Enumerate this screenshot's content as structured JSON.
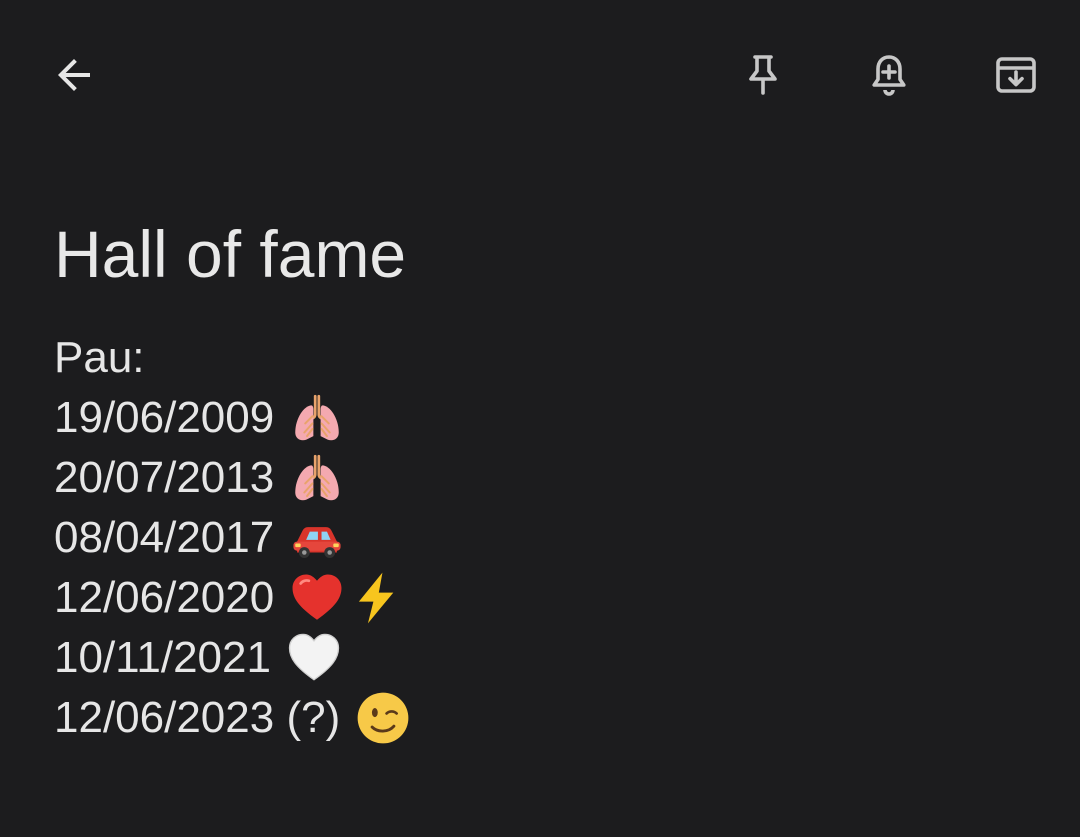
{
  "toolbar": {
    "back_icon": "arrow-left-icon",
    "pin_icon": "pin-icon",
    "reminder_icon": "bell-plus-icon",
    "archive_icon": "archive-icon",
    "icon_color": "#c7c7c7"
  },
  "note": {
    "title": "Hall of fame",
    "lines": [
      {
        "text": "Pau:",
        "emojis": []
      },
      {
        "text": "19/06/2009",
        "emojis": [
          "lungs"
        ]
      },
      {
        "text": "20/07/2013",
        "emojis": [
          "lungs"
        ]
      },
      {
        "text": "08/04/2017",
        "emojis": [
          "car"
        ]
      },
      {
        "text": "12/06/2020",
        "emojis": [
          "red-heart",
          "lightning"
        ]
      },
      {
        "text": "10/11/2021",
        "emojis": [
          "white-heart"
        ]
      },
      {
        "text": "12/06/2023 (?)",
        "emojis": [
          "winking-face"
        ]
      }
    ]
  },
  "colors": {
    "background": "#1c1c1e",
    "text": "#e6e6e6"
  }
}
